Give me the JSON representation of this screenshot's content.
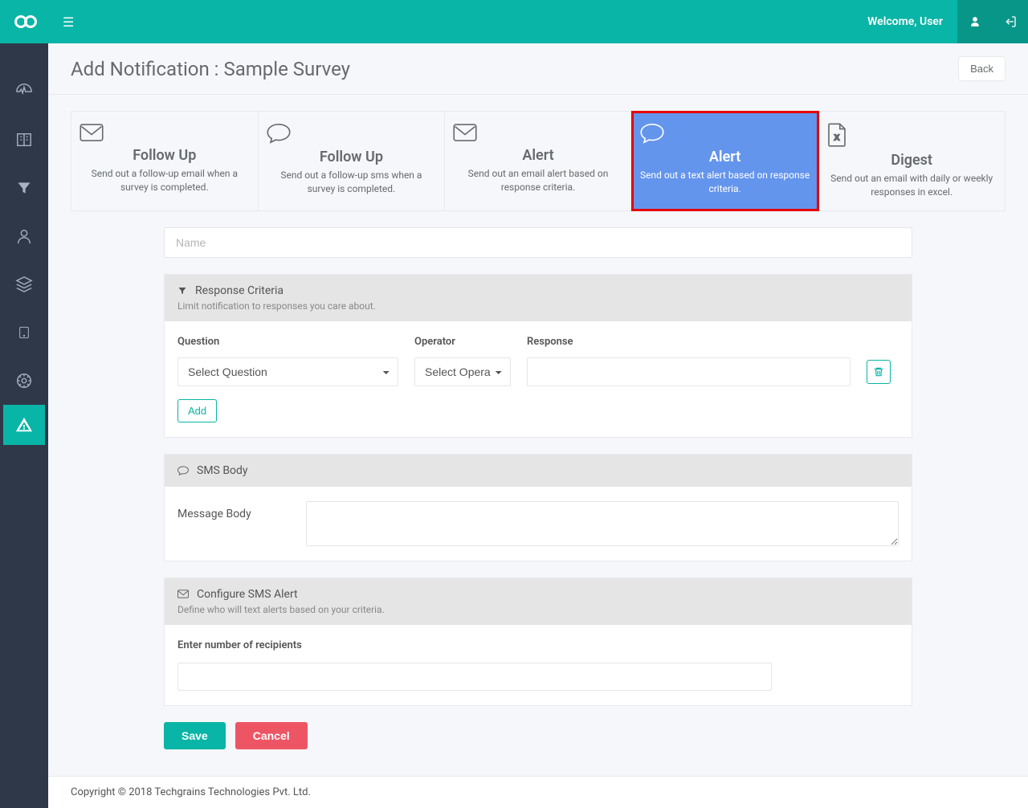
{
  "header": {
    "welcome": "Welcome, User"
  },
  "page": {
    "title": "Add Notification : Sample Survey",
    "back": "Back"
  },
  "tabs": [
    {
      "title": "Follow Up",
      "desc": "Send out a follow-up email when a survey is completed.",
      "icon": "envelope"
    },
    {
      "title": "Follow Up",
      "desc": "Send out a follow-up sms when a survey is completed.",
      "icon": "chat"
    },
    {
      "title": "Alert",
      "desc": "Send out an email alert based on response criteria.",
      "icon": "envelope"
    },
    {
      "title": "Alert",
      "desc": "Send out a text alert based on response criteria.",
      "icon": "chat"
    },
    {
      "title": "Digest",
      "desc": "Send out an email with daily or weekly responses in excel.",
      "icon": "excel"
    }
  ],
  "name": {
    "placeholder": "Name"
  },
  "criteria": {
    "title": "Response Criteria",
    "sub": "Limit notification to responses you care about.",
    "question_label": "Question",
    "operator_label": "Operator",
    "response_label": "Response",
    "question_select": "Select Question",
    "operator_select": "Select Opera",
    "add": "Add"
  },
  "sms": {
    "title": "SMS Body",
    "label": "Message Body"
  },
  "configure": {
    "title": "Configure SMS Alert",
    "sub": "Define who will text alerts based on your criteria.",
    "recipients_label": "Enter number of recipients"
  },
  "actions": {
    "save": "Save",
    "cancel": "Cancel"
  },
  "footer": "Copyright © 2018 Techgrains Technologies Pvt. Ltd."
}
